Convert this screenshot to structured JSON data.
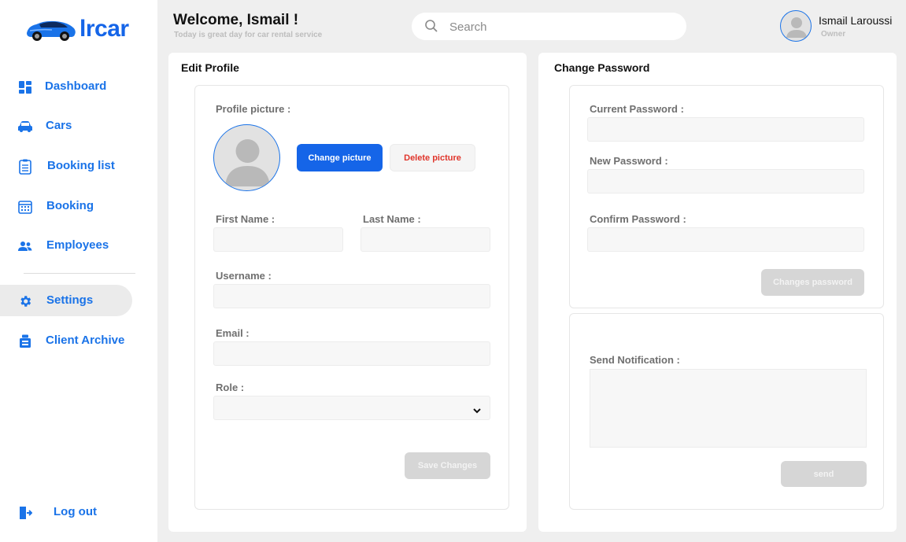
{
  "brand": {
    "name": "lrcar",
    "accent": "#1565e8"
  },
  "sidebar": {
    "items": [
      {
        "label": "Dashboard",
        "icon": "dashboard-icon"
      },
      {
        "label": "Cars",
        "icon": "car-icon"
      },
      {
        "label": "Booking list",
        "icon": "clipboard-icon"
      },
      {
        "label": "Booking",
        "icon": "calendar-icon"
      },
      {
        "label": "Employees",
        "icon": "users-icon"
      },
      {
        "label": "Settings",
        "icon": "gear-icon",
        "active": true
      },
      {
        "label": "Client Archive",
        "icon": "archive-icon"
      }
    ],
    "logout": {
      "label": "Log out",
      "icon": "logout-icon"
    }
  },
  "header": {
    "welcome": "Welcome, Ismail !",
    "subtitle": "Today is great day for car rental service",
    "search_placeholder": "Search",
    "user": {
      "name": "Ismail Laroussi",
      "role": "Owner"
    }
  },
  "edit_profile": {
    "title": "Edit Profile",
    "profile_picture_label": "Profile picture :",
    "change_picture": "Change picture",
    "delete_picture": "Delete picture",
    "first_name_label": "First Name :",
    "last_name_label": "Last Name :",
    "username_label": "Username :",
    "email_label": "Email :",
    "role_label": "Role :",
    "save": "Save Changes"
  },
  "change_password": {
    "title": "Change Password",
    "current_label": "Current Password :",
    "new_label": "New Password :",
    "confirm_label": "Confirm Password :",
    "submit": "Changes password"
  },
  "notification": {
    "label": "Send Notification :",
    "send": "send"
  }
}
